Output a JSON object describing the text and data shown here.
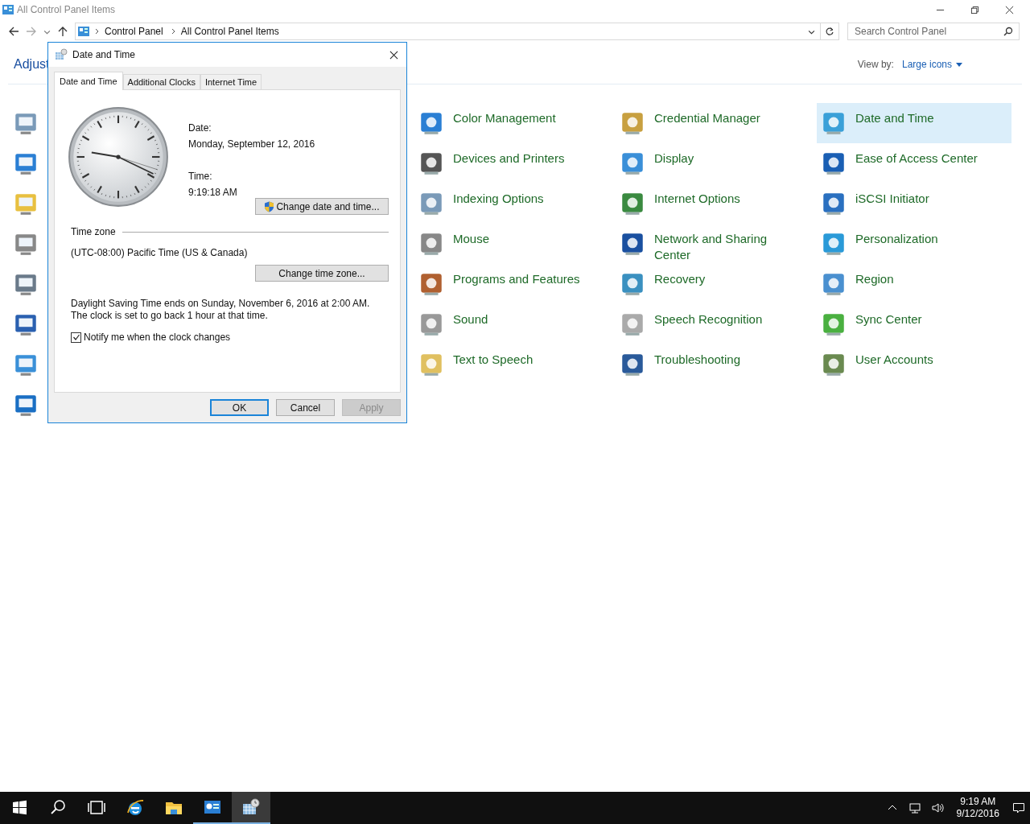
{
  "window": {
    "title": "All Control Panel Items"
  },
  "address_bar": {
    "path": [
      "Control Panel",
      "All Control Panel Items"
    ]
  },
  "search": {
    "placeholder": "Search Control Panel"
  },
  "heading": "Adjust",
  "view_by": {
    "label": "View by:",
    "value": "Large icons"
  },
  "items": [
    {
      "label": "Color Management",
      "selected": false
    },
    {
      "label": "Credential Manager",
      "selected": false
    },
    {
      "label": "Date and Time",
      "selected": true
    },
    {
      "label": "Devices and Printers",
      "selected": false
    },
    {
      "label": "Display",
      "selected": false
    },
    {
      "label": "Ease of Access Center",
      "selected": false
    },
    {
      "label": "Indexing Options",
      "selected": false
    },
    {
      "label": "Internet Options",
      "selected": false
    },
    {
      "label": "iSCSI Initiator",
      "selected": false
    },
    {
      "label": "Mouse",
      "selected": false
    },
    {
      "label": "Network and Sharing Center",
      "selected": false
    },
    {
      "label": "Personalization",
      "selected": false
    },
    {
      "label": "Programs and Features",
      "selected": false
    },
    {
      "label": "Recovery",
      "selected": false
    },
    {
      "label": "Region",
      "selected": false
    },
    {
      "label": "Sound",
      "selected": false
    },
    {
      "label": "Speech Recognition",
      "selected": false
    },
    {
      "label": "Sync Center",
      "selected": false
    },
    {
      "label": "Text to Speech",
      "selected": false
    },
    {
      "label": "Troubleshooting",
      "selected": false
    },
    {
      "label": "User Accounts",
      "selected": false
    }
  ],
  "dialog": {
    "title": "Date and Time",
    "tabs": [
      {
        "label": "Date and Time",
        "selected": true
      },
      {
        "label": "Additional Clocks",
        "selected": false
      },
      {
        "label": "Internet Time",
        "selected": false
      }
    ],
    "date_label": "Date:",
    "date": "Monday, September 12, 2016",
    "time_label": "Time:",
    "time": "9:19:18 AM",
    "change_datetime_button": "Change date and time...",
    "time_zone_heading": "Time zone",
    "time_zone": "(UTC-08:00) Pacific Time (US & Canada)",
    "change_zone_button": "Change time zone...",
    "dst_note": "Daylight Saving Time ends on Sunday, November 6, 2016 at 2:00 AM. The clock is set to go back 1 hour at that time.",
    "notify": {
      "label": "Notify me when the clock changes",
      "checked": true
    },
    "buttons": [
      {
        "label": "OK",
        "kind": "default",
        "disabled": false
      },
      {
        "label": "Cancel",
        "kind": "normal",
        "disabled": false
      },
      {
        "label": "Apply",
        "kind": "normal",
        "disabled": true
      }
    ]
  },
  "taskbar": {
    "apps": [
      {
        "kind": "browser",
        "running": false,
        "selected": false
      },
      {
        "kind": "folder",
        "running": false,
        "selected": false
      },
      {
        "kind": "control-panel",
        "running": true,
        "selected": false
      },
      {
        "kind": "date-time",
        "running": true,
        "selected": true
      }
    ],
    "time": "9:19 AM",
    "date": "9/12/2016"
  }
}
